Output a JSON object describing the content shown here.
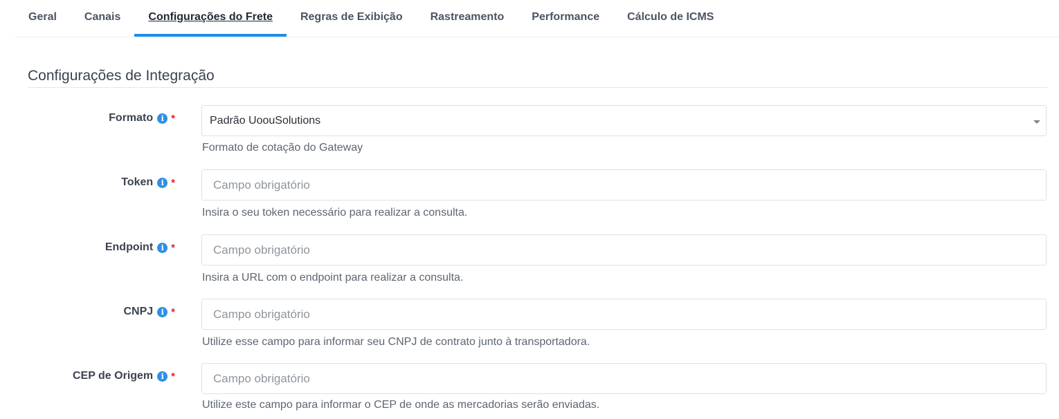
{
  "tabs": [
    {
      "label": "Geral",
      "active": false
    },
    {
      "label": "Canais",
      "active": false
    },
    {
      "label": "Configurações do Frete",
      "active": true
    },
    {
      "label": "Regras de Exibição",
      "active": false
    },
    {
      "label": "Rastreamento",
      "active": false
    },
    {
      "label": "Performance",
      "active": false
    },
    {
      "label": "Cálculo de ICMS",
      "active": false
    }
  ],
  "section": {
    "title": "Configurações de Integração"
  },
  "fields": {
    "formato": {
      "label": "Formato",
      "info_icon": "info-icon",
      "required_mark": "*",
      "value": "Padrão UoouSolutions",
      "help": "Formato de cotação do Gateway"
    },
    "token": {
      "label": "Token",
      "info_icon": "info-icon",
      "required_mark": "*",
      "placeholder": "Campo obrigatório",
      "help": "Insira o seu token necessário para realizar a consulta."
    },
    "endpoint": {
      "label": "Endpoint",
      "info_icon": "info-icon",
      "required_mark": "*",
      "placeholder": "Campo obrigatório",
      "help": "Insira a URL com o endpoint para realizar a consulta."
    },
    "cnpj": {
      "label": "CNPJ",
      "info_icon": "info-icon",
      "required_mark": "*",
      "placeholder": "Campo obrigatório",
      "help": "Utilize esse campo para informar seu CNPJ de contrato junto à transportadora."
    },
    "cep_origem": {
      "label": "CEP de Origem",
      "info_icon": "info-icon",
      "required_mark": "*",
      "placeholder": "Campo obrigatório",
      "help": "Utilize este campo para informar o CEP de onde as mercadorias serão enviadas."
    }
  },
  "colors": {
    "accent": "#1e8fe8",
    "required": "#e0242a",
    "info": "#2e90e4"
  }
}
